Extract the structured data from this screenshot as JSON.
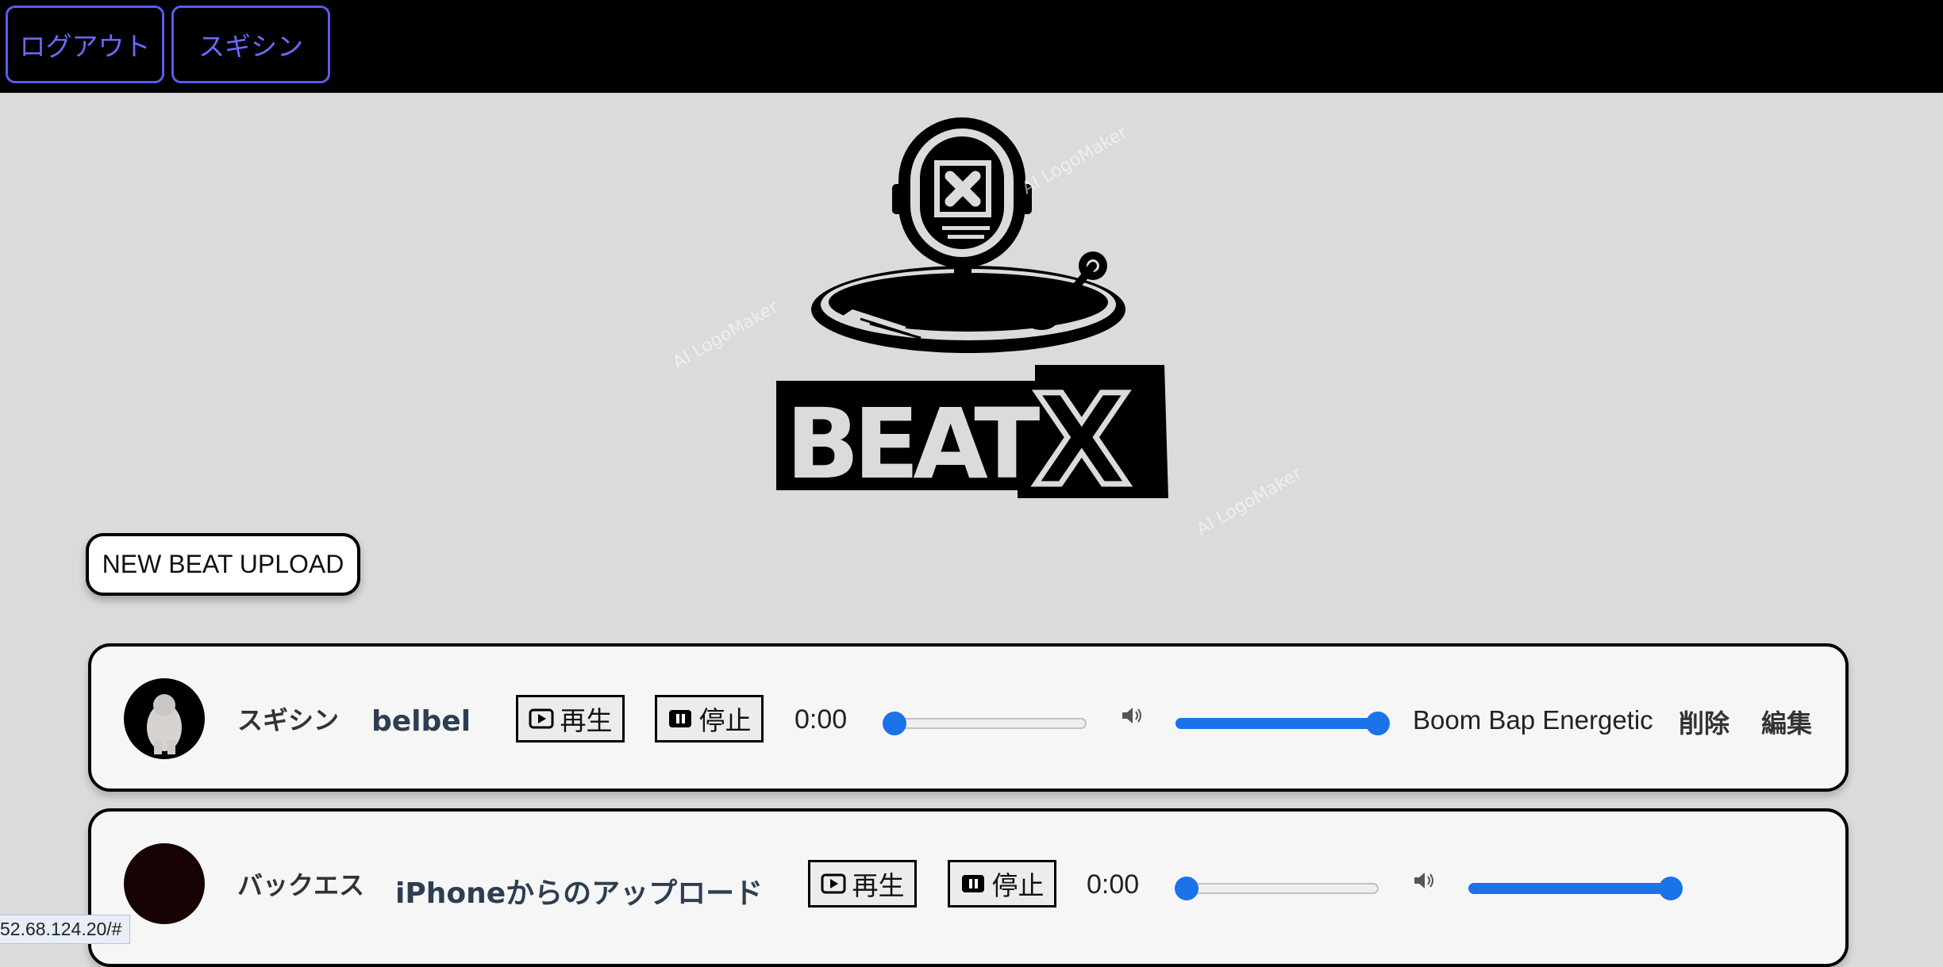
{
  "header": {
    "logout_label": "ログアウト",
    "user_label": "スギシン"
  },
  "logo": {
    "wordmark": "BEATX",
    "watermark": "AI LogoMaker"
  },
  "upload_button_label": "NEW BEAT UPLOAD",
  "beats": [
    {
      "username": "スギシン",
      "title": "belbel",
      "play_label": "再生",
      "stop_label": "停止",
      "time": "0:00",
      "seek_progress": 0,
      "volume": 1.0,
      "tag": "Boom Bap Energetic",
      "delete_label": "削除",
      "edit_label": "編集"
    },
    {
      "username": "バックエス",
      "title": "iPhoneからのアップロード",
      "play_label": "再生",
      "stop_label": "停止",
      "time": "0:00",
      "seek_progress": 0,
      "volume": 1.0
    }
  ],
  "status_bar_url": "52.68.124.20/#",
  "colors": {
    "accent_blue": "#1a73e8",
    "header_button": "#5b5bf0",
    "background": "#dcdbdc"
  }
}
